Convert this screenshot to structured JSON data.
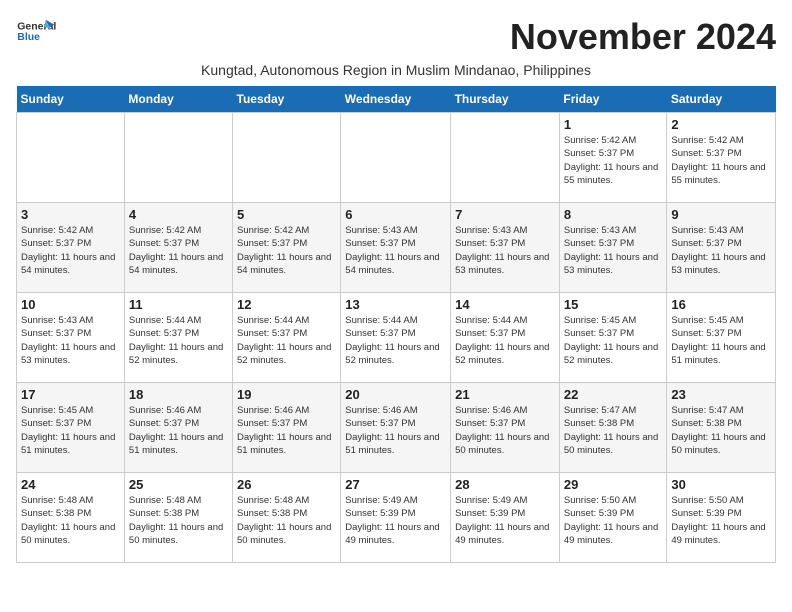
{
  "header": {
    "logo_line1": "General",
    "logo_line2": "Blue",
    "month": "November 2024",
    "subtitle": "Kungtad, Autonomous Region in Muslim Mindanao, Philippines"
  },
  "days_of_week": [
    "Sunday",
    "Monday",
    "Tuesday",
    "Wednesday",
    "Thursday",
    "Friday",
    "Saturday"
  ],
  "weeks": [
    [
      {
        "num": "",
        "info": ""
      },
      {
        "num": "",
        "info": ""
      },
      {
        "num": "",
        "info": ""
      },
      {
        "num": "",
        "info": ""
      },
      {
        "num": "",
        "info": ""
      },
      {
        "num": "1",
        "info": "Sunrise: 5:42 AM\nSunset: 5:37 PM\nDaylight: 11 hours and 55 minutes."
      },
      {
        "num": "2",
        "info": "Sunrise: 5:42 AM\nSunset: 5:37 PM\nDaylight: 11 hours and 55 minutes."
      }
    ],
    [
      {
        "num": "3",
        "info": "Sunrise: 5:42 AM\nSunset: 5:37 PM\nDaylight: 11 hours and 54 minutes."
      },
      {
        "num": "4",
        "info": "Sunrise: 5:42 AM\nSunset: 5:37 PM\nDaylight: 11 hours and 54 minutes."
      },
      {
        "num": "5",
        "info": "Sunrise: 5:42 AM\nSunset: 5:37 PM\nDaylight: 11 hours and 54 minutes."
      },
      {
        "num": "6",
        "info": "Sunrise: 5:43 AM\nSunset: 5:37 PM\nDaylight: 11 hours and 54 minutes."
      },
      {
        "num": "7",
        "info": "Sunrise: 5:43 AM\nSunset: 5:37 PM\nDaylight: 11 hours and 53 minutes."
      },
      {
        "num": "8",
        "info": "Sunrise: 5:43 AM\nSunset: 5:37 PM\nDaylight: 11 hours and 53 minutes."
      },
      {
        "num": "9",
        "info": "Sunrise: 5:43 AM\nSunset: 5:37 PM\nDaylight: 11 hours and 53 minutes."
      }
    ],
    [
      {
        "num": "10",
        "info": "Sunrise: 5:43 AM\nSunset: 5:37 PM\nDaylight: 11 hours and 53 minutes."
      },
      {
        "num": "11",
        "info": "Sunrise: 5:44 AM\nSunset: 5:37 PM\nDaylight: 11 hours and 52 minutes."
      },
      {
        "num": "12",
        "info": "Sunrise: 5:44 AM\nSunset: 5:37 PM\nDaylight: 11 hours and 52 minutes."
      },
      {
        "num": "13",
        "info": "Sunrise: 5:44 AM\nSunset: 5:37 PM\nDaylight: 11 hours and 52 minutes."
      },
      {
        "num": "14",
        "info": "Sunrise: 5:44 AM\nSunset: 5:37 PM\nDaylight: 11 hours and 52 minutes."
      },
      {
        "num": "15",
        "info": "Sunrise: 5:45 AM\nSunset: 5:37 PM\nDaylight: 11 hours and 52 minutes."
      },
      {
        "num": "16",
        "info": "Sunrise: 5:45 AM\nSunset: 5:37 PM\nDaylight: 11 hours and 51 minutes."
      }
    ],
    [
      {
        "num": "17",
        "info": "Sunrise: 5:45 AM\nSunset: 5:37 PM\nDaylight: 11 hours and 51 minutes."
      },
      {
        "num": "18",
        "info": "Sunrise: 5:46 AM\nSunset: 5:37 PM\nDaylight: 11 hours and 51 minutes."
      },
      {
        "num": "19",
        "info": "Sunrise: 5:46 AM\nSunset: 5:37 PM\nDaylight: 11 hours and 51 minutes."
      },
      {
        "num": "20",
        "info": "Sunrise: 5:46 AM\nSunset: 5:37 PM\nDaylight: 11 hours and 51 minutes."
      },
      {
        "num": "21",
        "info": "Sunrise: 5:46 AM\nSunset: 5:37 PM\nDaylight: 11 hours and 50 minutes."
      },
      {
        "num": "22",
        "info": "Sunrise: 5:47 AM\nSunset: 5:38 PM\nDaylight: 11 hours and 50 minutes."
      },
      {
        "num": "23",
        "info": "Sunrise: 5:47 AM\nSunset: 5:38 PM\nDaylight: 11 hours and 50 minutes."
      }
    ],
    [
      {
        "num": "24",
        "info": "Sunrise: 5:48 AM\nSunset: 5:38 PM\nDaylight: 11 hours and 50 minutes."
      },
      {
        "num": "25",
        "info": "Sunrise: 5:48 AM\nSunset: 5:38 PM\nDaylight: 11 hours and 50 minutes."
      },
      {
        "num": "26",
        "info": "Sunrise: 5:48 AM\nSunset: 5:38 PM\nDaylight: 11 hours and 50 minutes."
      },
      {
        "num": "27",
        "info": "Sunrise: 5:49 AM\nSunset: 5:39 PM\nDaylight: 11 hours and 49 minutes."
      },
      {
        "num": "28",
        "info": "Sunrise: 5:49 AM\nSunset: 5:39 PM\nDaylight: 11 hours and 49 minutes."
      },
      {
        "num": "29",
        "info": "Sunrise: 5:50 AM\nSunset: 5:39 PM\nDaylight: 11 hours and 49 minutes."
      },
      {
        "num": "30",
        "info": "Sunrise: 5:50 AM\nSunset: 5:39 PM\nDaylight: 11 hours and 49 minutes."
      }
    ]
  ]
}
